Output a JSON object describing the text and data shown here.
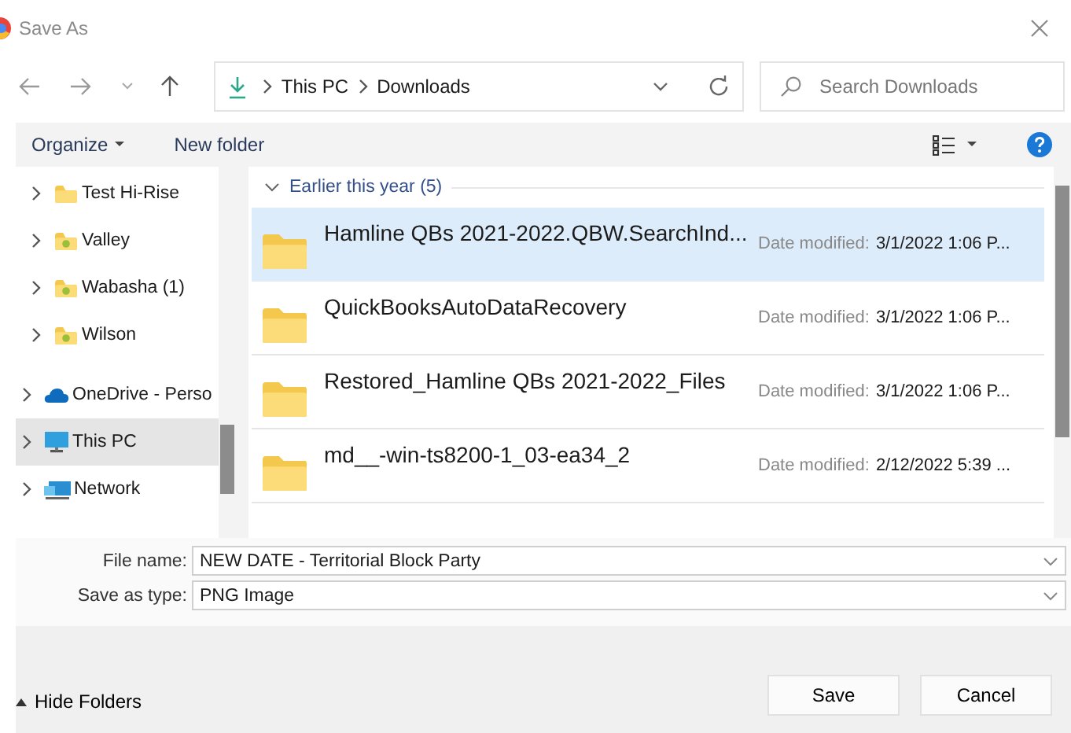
{
  "window": {
    "title": "Save As"
  },
  "address": {
    "segments": [
      "This PC",
      "Downloads"
    ]
  },
  "search": {
    "placeholder": "Search Downloads"
  },
  "commands": [
    {
      "label": "Organize",
      "menu": true
    },
    {
      "label": "New folder",
      "menu": false
    }
  ],
  "sidebar": {
    "items": [
      {
        "children": [
          {
            "label": "Test Hi-Rise",
            "kind": "folder",
            "selected": false
          },
          {
            "label": "Valley",
            "kind": "shared-folder",
            "selected": false
          },
          {
            "label": "Wabasha (1)",
            "kind": "shared-folder",
            "selected": false
          },
          {
            "label": "Wilson",
            "kind": "shared-folder",
            "selected": false
          }
        ]
      },
      {
        "label": "OneDrive - Perso",
        "kind": "cloud",
        "selected": false
      },
      {
        "label": "This PC",
        "kind": "computer",
        "selected": true
      },
      {
        "label": "Network",
        "kind": "network",
        "selected": false
      }
    ]
  },
  "group": {
    "label": "Earlier this year (5)",
    "expanded": true
  },
  "files": [
    {
      "name": "Hamline QBs 2021-2022.QBW.SearchInd...",
      "date_label": "Date modified:",
      "date": "3/1/2022 1:06 P...",
      "selected": true
    },
    {
      "name": "QuickBooksAutoDataRecovery",
      "date_label": "Date modified:",
      "date": "3/1/2022 1:06 P...",
      "selected": false
    },
    {
      "name": "Restored_Hamline QBs 2021-2022_Files",
      "date_label": "Date modified:",
      "date": "3/1/2022 1:06 P...",
      "selected": false
    },
    {
      "name": "md__-win-ts8200-1_03-ea34_2",
      "date_label": "Date modified:",
      "date": "2/12/2022 5:39 ...",
      "selected": false
    }
  ],
  "fields": [
    {
      "label": "File name:",
      "value": "NEW DATE - Territorial Block Party"
    },
    {
      "label": "Save as type:",
      "value": "PNG Image"
    }
  ],
  "hide_folders": "Hide Folders",
  "buttons": [
    "Save",
    "Cancel"
  ]
}
